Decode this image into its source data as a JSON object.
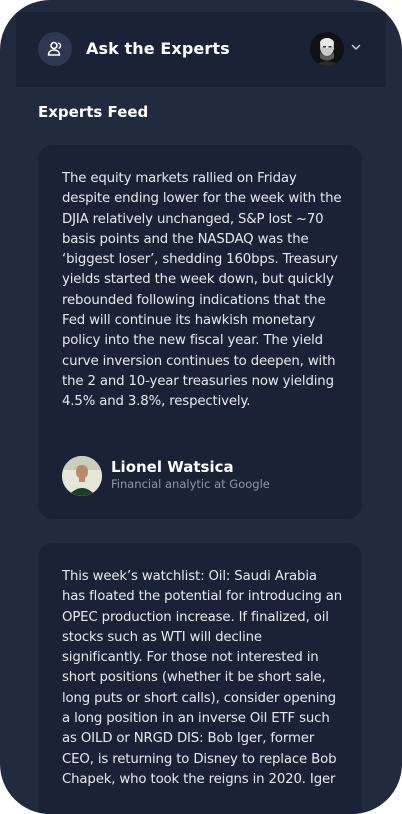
{
  "header": {
    "title": "Ask the Experts",
    "brand_icon": "users-icon",
    "profile_icon": "profile-avatar",
    "menu_icon": "chevron-down-icon"
  },
  "feed": {
    "title": "Experts Feed",
    "posts": [
      {
        "text": "The equity markets rallied on Friday despite ending lower for the week with the DJIA relatively unchanged, S&P lost ~70 basis points and the NASDAQ was the ‘biggest loser’, shedding 160bps. Treasury yields started the week down, but quickly rebounded following indications that the Fed will continue its hawkish monetary policy into the new fiscal year. The yield curve inversion continues to deepen, with the 2 and 10-year treasuries now yielding 4.5% and 3.8%, respectively.",
        "author": {
          "name": "Lionel Watsica",
          "role": "Financial analytic at Google"
        }
      },
      {
        "text": "This week’s watchlist: Oil: Saudi Arabia has floated the potential for introducing an OPEC production increase. If finalized, oil stocks such as WTI will decline significantly. For those not interested in short positions (whether it be short sale, long puts or short calls), consider opening a long position in an inverse Oil ETF such as OILD or NRGD DIS: Bob Iger, former CEO, is returning to Disney to replace Bob Chapek, who took the reigns in 2020. Iger"
      }
    ]
  },
  "colors": {
    "background": "#222a3e",
    "header": "#1b2235",
    "card": "#1b2235",
    "text": "#e6e9ef",
    "muted": "#8c96ae"
  }
}
